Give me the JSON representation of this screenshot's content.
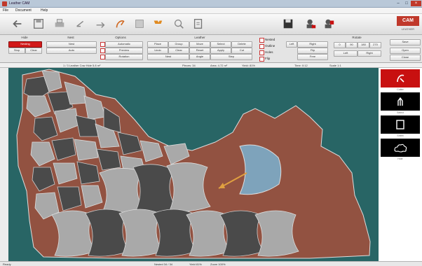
{
  "window": {
    "title": "Leather CAM",
    "minimize": "–",
    "maximize": "□",
    "close": "×"
  },
  "menu": [
    {
      "label": "File"
    },
    {
      "label": "Document"
    },
    {
      "label": "Help"
    }
  ],
  "toolbar": {
    "tools": [
      {
        "icon": "back-arrow-icon"
      },
      {
        "icon": "save-icon"
      },
      {
        "icon": "print-icon"
      },
      {
        "icon": "rotate-left-icon"
      },
      {
        "icon": "rotate-right-icon"
      },
      {
        "icon": "curve-tool-icon"
      },
      {
        "icon": "grid-icon"
      },
      {
        "icon": "flag-icon"
      },
      {
        "icon": "zoom-icon"
      },
      {
        "icon": "move-icon"
      },
      {
        "icon": "disk-icon"
      },
      {
        "icon": "user-icon"
      },
      {
        "icon": "user-remove-icon"
      }
    ],
    "brand": {
      "logo": "CAM",
      "text": "LEATHER"
    }
  },
  "panel": {
    "groups": {
      "left": "Hide",
      "nest": "Nest",
      "options": "Options",
      "center": "Leather",
      "rotate": "Rotate",
      "right": "Rotate"
    },
    "buttons": {
      "start": "Nesting",
      "left2": "Stop",
      "left3": "Clear",
      "nest1": "Nest",
      "nest2": "Auto",
      "opt1": "Automatic",
      "opt2": "Preview",
      "opt3": "Rotation",
      "c1": "Place",
      "c2": "Group",
      "c3": "Move",
      "c4": "Select",
      "c5": "Delete",
      "c6": "Undo",
      "c7": "Clear",
      "c8": "Reset",
      "c9": "Apply",
      "c10": "Cut",
      "r1": "Left",
      "r2": "Right",
      "r3": "Flip",
      "r4": "Free",
      "far1": "Save",
      "far2": "Open",
      "far3": "Close"
    },
    "checks": [
      {
        "label": "Nested"
      },
      {
        "label": "Outline"
      },
      {
        "label": "Holes"
      },
      {
        "label": "Flip"
      }
    ],
    "angles": [
      "0",
      "90",
      "180",
      "270"
    ],
    "angle_labels": [
      "Nest",
      "Angle",
      "Step"
    ]
  },
  "infostrip": [
    "1 / 3 Leather Cow  Hide  5.8 m²",
    "Pieces: 34",
    "Area: 4.72 m²",
    "Yield: 81%",
    "Time: 0:12",
    "Scale 1:1"
  ],
  "palette": [
    {
      "icon": "cut-tool-icon",
      "caption": "Cutter"
    },
    {
      "icon": "hand-tool-icon",
      "caption": "Select"
    },
    {
      "icon": "page-tool-icon",
      "caption": "Sheet"
    },
    {
      "icon": "cloud-tool-icon",
      "caption": "Hide"
    }
  ],
  "statusbar": [
    "Ready",
    "Nested 34 / 34",
    "Yield 81%",
    "Zoom 100%"
  ],
  "colors": {
    "canvas": "#286565",
    "hide": "#925241",
    "piece_light": "#a9a9a9",
    "piece_dark": "#4a4a4a",
    "selected": "#7ea3bb",
    "arrow": "#e0a040",
    "accent": "#c81010"
  }
}
